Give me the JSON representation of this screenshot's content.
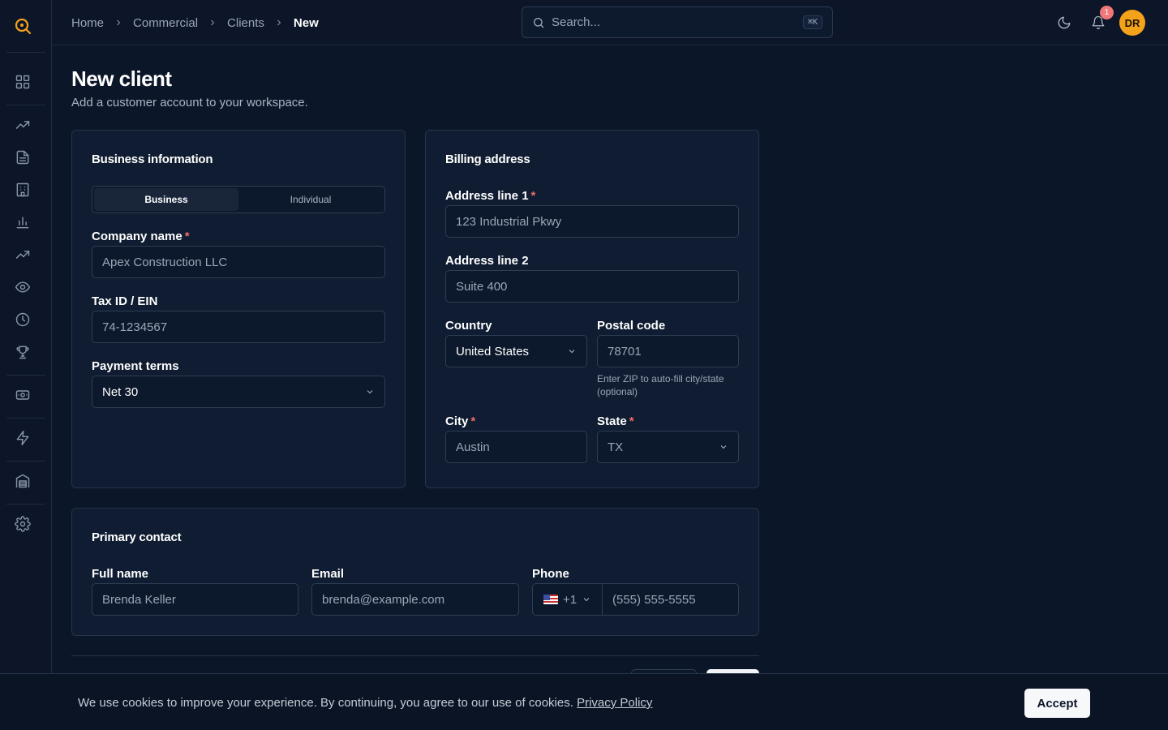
{
  "breadcrumb": {
    "items": [
      "Home",
      "Commercial",
      "Clients"
    ],
    "current": "New"
  },
  "search": {
    "placeholder": "Search...",
    "shortcut": "⌘K"
  },
  "header": {
    "notification_count": "1",
    "avatar_initials": "DR"
  },
  "page": {
    "title": "New client",
    "subtitle": "Add a customer account to your workspace."
  },
  "business_info": {
    "title": "Business information",
    "toggle": [
      "Business",
      "Individual"
    ],
    "toggle_selected": "Business",
    "company_name_label": "Company name",
    "company_name_placeholder": "Apex Construction LLC",
    "tax_id_label": "Tax ID / EIN",
    "tax_id_placeholder": "74-1234567",
    "payment_terms_label": "Payment terms",
    "payment_terms_value": "Net 30"
  },
  "billing": {
    "title": "Billing address",
    "address1_label": "Address line 1",
    "address1_placeholder": "123 Industrial Pkwy",
    "address2_label": "Address line 2",
    "address2_placeholder": "Suite 400",
    "country_label": "Country",
    "country_value": "United States",
    "postal_label": "Postal code",
    "postal_placeholder": "78701",
    "postal_helper": "Enter ZIP to auto-fill city/state (optional)",
    "city_label": "City",
    "city_placeholder": "Austin",
    "state_label": "State",
    "state_value": "TX"
  },
  "contact": {
    "title": "Primary contact",
    "fullname_label": "Full name",
    "fullname_placeholder": "Brenda Keller",
    "email_label": "Email",
    "email_placeholder": "brenda@example.com",
    "phone_label": "Phone",
    "phone_code": "+1",
    "phone_placeholder": "(555) 555-5555"
  },
  "cookie": {
    "text": "We use cookies to improve your experience. By continuing, you agree to our use of cookies.",
    "link": "Privacy Policy",
    "accept": "Accept"
  },
  "colors": {
    "background": "#0b1628",
    "accent": "#f5a21b",
    "required": "#f06a6a",
    "badge": "#f07878"
  },
  "icons": {
    "sidebar": [
      "logo-search-icon",
      "dashboard-icon",
      "trending-up-icon",
      "document-icon",
      "building-icon",
      "bar-chart-icon",
      "trending-up-icon",
      "eye-icon",
      "clock-icon",
      "trophy-icon",
      "banknote-icon",
      "zap-icon",
      "warehouse-icon",
      "settings-icon"
    ],
    "topbar": [
      "moon-icon",
      "bell-icon"
    ]
  }
}
